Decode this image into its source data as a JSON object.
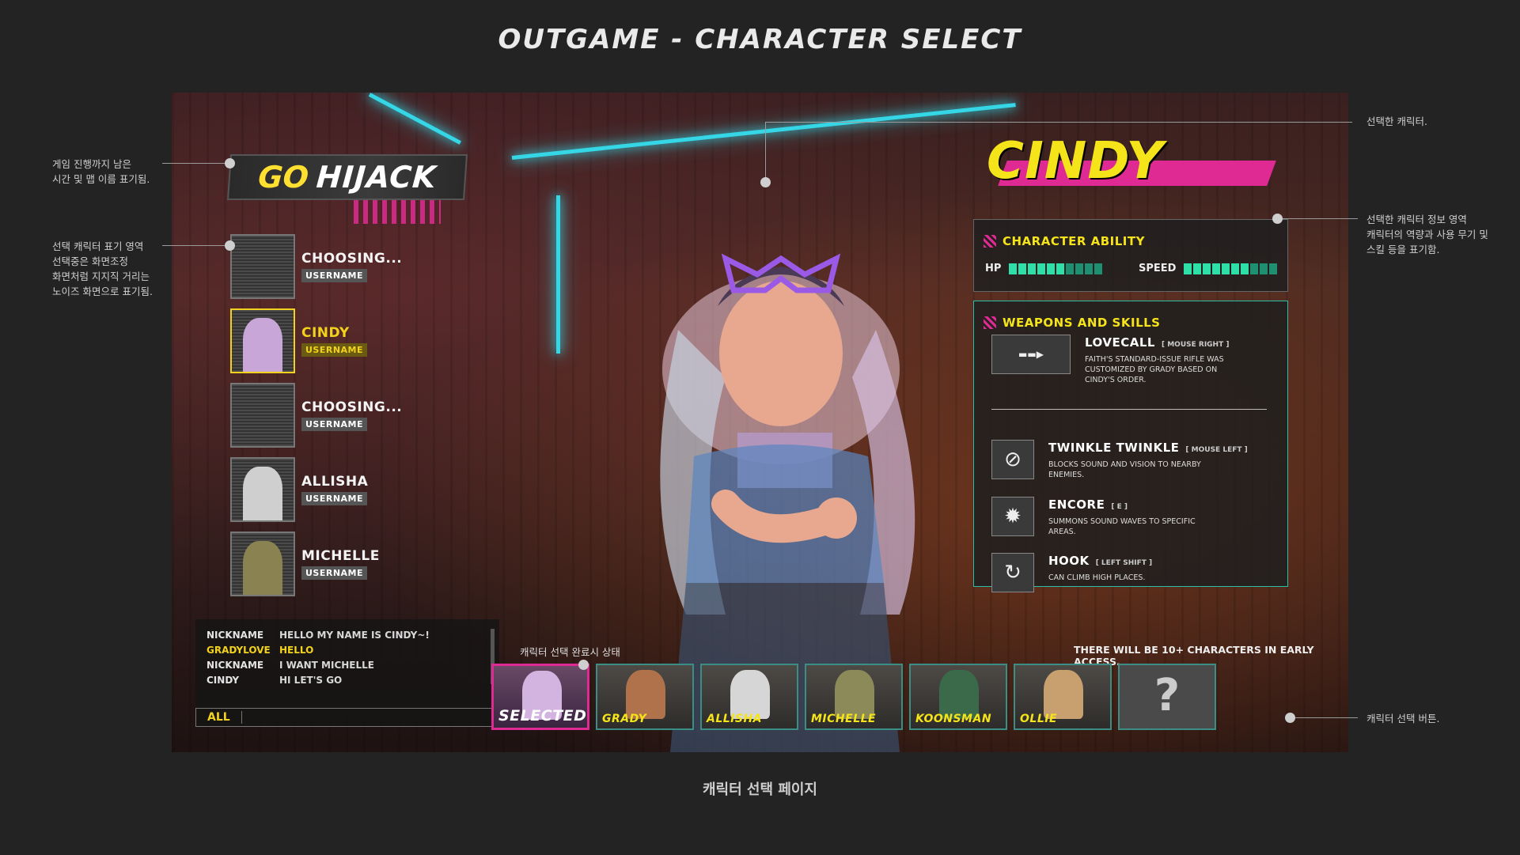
{
  "page": {
    "title": "OUTGAME - CHARACTER SELECT",
    "caption": "캐릭터 선택 페이지"
  },
  "annotations": {
    "timer_map": [
      "게임 진행까지 남은",
      "시간 및 맵 이름 표기됨."
    ],
    "slot_area": [
      "선택 캐릭터 표기 영역",
      "선택중은 화면조정",
      "화면처럼 지지직 거리는",
      "노이즈 화면으로 표기됨."
    ],
    "selected_char": "선택한 캐릭터.",
    "info_area": [
      "선택한 캐릭터 정보 영역",
      "캐릭터의 역량과 사용 무기 및",
      "스킬 등을 표기함."
    ],
    "select_button": "캐릭터 선택 버튼.",
    "selected_state": "캐릭터 선택 완료시 상태"
  },
  "game": {
    "mode_prefix": "GO",
    "map_name": "HIJACK",
    "selected_character": "CINDY",
    "slots": [
      {
        "name": "CHOOSING...",
        "user": "USERNAME",
        "state": "choosing"
      },
      {
        "name": "CINDY",
        "user": "USERNAME",
        "state": "active",
        "color": "#c8a6d8"
      },
      {
        "name": "CHOOSING...",
        "user": "USERNAME",
        "state": "choosing"
      },
      {
        "name": "ALLISHA",
        "user": "USERNAME",
        "state": "picked",
        "color": "#cfcfcf"
      },
      {
        "name": "MICHELLE",
        "user": "USERNAME",
        "state": "picked",
        "color": "#8a8250"
      }
    ],
    "chat": {
      "rows": [
        {
          "who": "NICKNAME",
          "msg": "HELLO MY NAME IS CINDY~!",
          "highlight": false
        },
        {
          "who": "GRADYLOVE",
          "msg": "HELLO",
          "highlight": true
        },
        {
          "who": "NICKNAME",
          "msg": "I WANT MICHELLE",
          "highlight": false
        },
        {
          "who": "CINDY",
          "msg": "HI LET'S GO",
          "highlight": false
        }
      ],
      "channel_tab": "ALL"
    },
    "ability": {
      "title": "CHARACTER ABILITY",
      "hp_label": "HP",
      "hp_value": 6,
      "speed_label": "SPEED",
      "speed_value": 7,
      "max": 10
    },
    "weapons": {
      "title": "WEAPONS AND SKILLS",
      "items": [
        {
          "name": "LOVECALL",
          "key": "[ MOUSE RIGHT ]",
          "desc": "FAITH'S STANDARD-ISSUE RIFLE WAS CUSTOMIZED BY GRADY BASED ON CINDY'S ORDER.",
          "icon": "rifle-icon"
        },
        {
          "name": "TWINKLE TWINKLE",
          "key": "[ MOUSE LEFT ]",
          "desc": "BLOCKS SOUND AND VISION TO NEARBY ENEMIES.",
          "icon": "eye-slash-icon"
        },
        {
          "name": "ENCORE",
          "key": "[ E ]",
          "desc": "SUMMONS SOUND WAVES TO SPECIFIC AREAS.",
          "icon": "bomb-icon"
        },
        {
          "name": "HOOK",
          "key": "[ LEFT SHIFT ]",
          "desc": "CAN CLIMB HIGH PLACES.",
          "icon": "hook-icon"
        }
      ]
    },
    "early_access": "THERE WILL BE 10+ CHARACTERS IN EARLY ACCESS.",
    "roster": [
      {
        "label": "SELECTED",
        "selected": true,
        "color": "#d3b3e0"
      },
      {
        "label": "GRADY",
        "selected": false,
        "color": "#b0724a"
      },
      {
        "label": "ALLISHA",
        "selected": false,
        "color": "#d6d6d6"
      },
      {
        "label": "MICHELLE",
        "selected": false,
        "color": "#8d8a5a"
      },
      {
        "label": "KOONSMAN",
        "selected": false,
        "color": "#3a6a4a"
      },
      {
        "label": "OLLIE",
        "selected": false,
        "color": "#c8a070"
      },
      {
        "label": "?",
        "selected": false,
        "unknown": true
      }
    ]
  },
  "colors": {
    "accent_yellow": "#f5e419",
    "accent_pink": "#e02a93",
    "accent_teal": "#2ee0a8",
    "neon_cyan": "#35d6e6"
  }
}
